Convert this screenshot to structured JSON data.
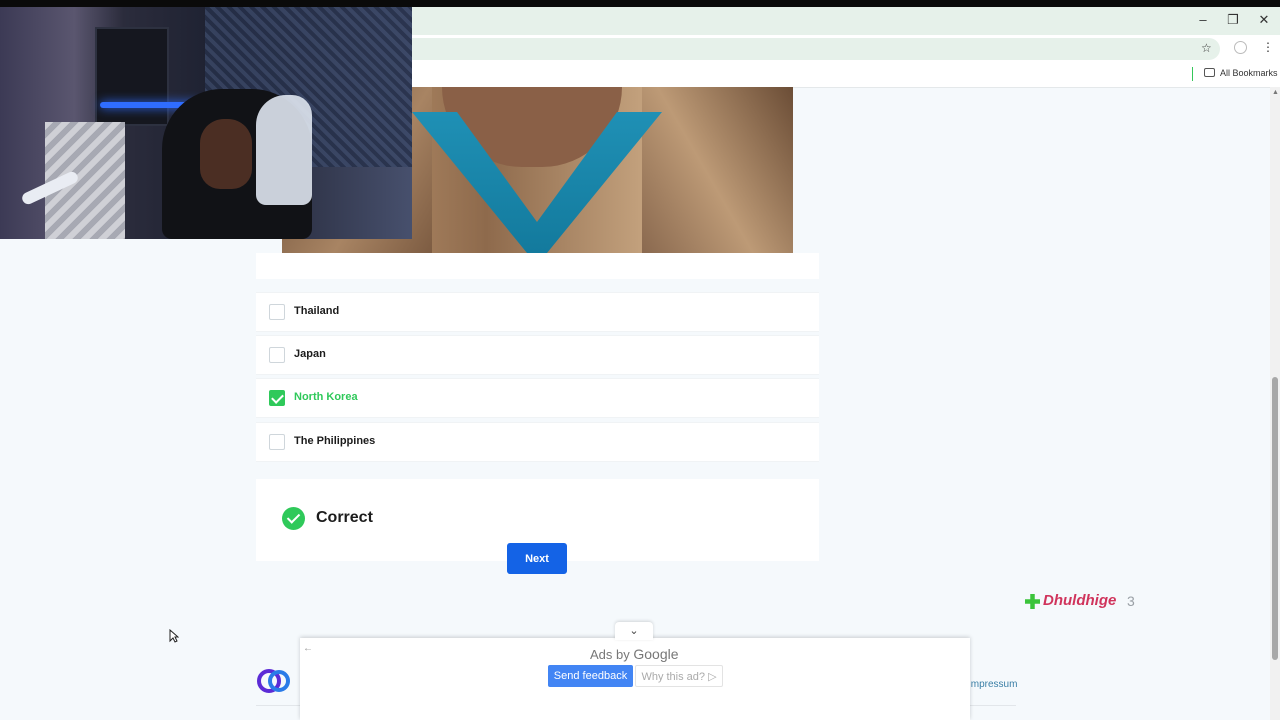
{
  "browser": {
    "bookmarks_label": "All Bookmarks",
    "icons": [
      "minimize-icon",
      "restore-icon",
      "close-icon",
      "star-icon",
      "profile-icon",
      "menu-icon",
      "folder-icon"
    ]
  },
  "question": {
    "options": [
      {
        "label": "Thailand",
        "checked": false
      },
      {
        "label": "Japan",
        "checked": false
      },
      {
        "label": "North Korea",
        "checked": true
      },
      {
        "label": "The Philippines",
        "checked": false
      }
    ],
    "result": "Correct",
    "next_label": "Next"
  },
  "overlay": {
    "name": "Dhuldhige",
    "count": "3"
  },
  "ad": {
    "ads_by": "Ads by",
    "google": "Google",
    "send_feedback": "Send feedback",
    "why_this_ad": "Why this ad?"
  },
  "footer": {
    "impressum": "Impressum"
  },
  "colors": {
    "accent_blue": "#1463e6",
    "correct_green": "#2fc95a",
    "overlay_pink": "#d0345c"
  }
}
